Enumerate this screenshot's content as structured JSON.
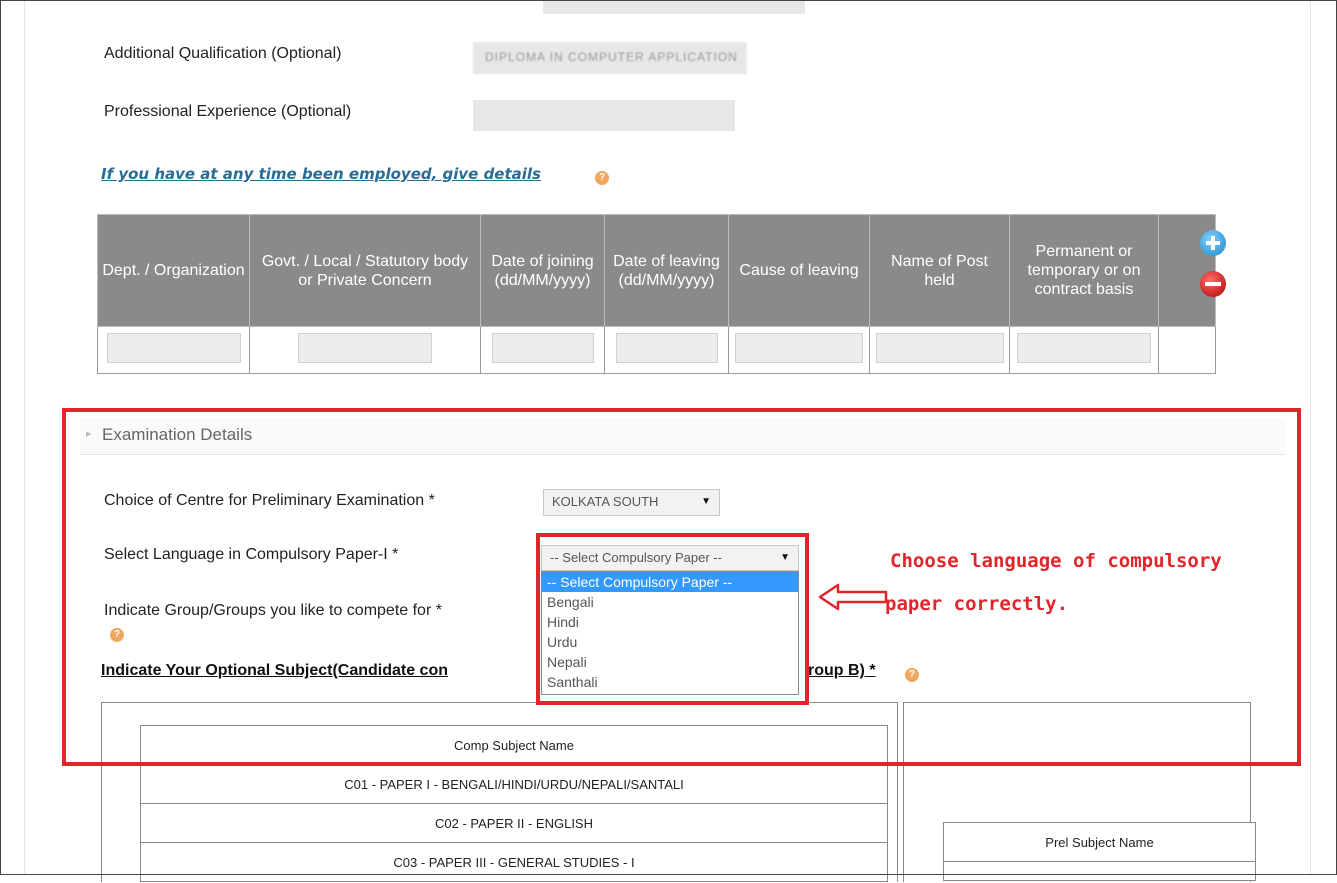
{
  "form": {
    "additional_qualification_label": "Additional Qualification (Optional)",
    "additional_qualification_value": "DIPLOMA IN COMPUTER APPLICATION",
    "professional_experience_label": "Professional Experience (Optional)",
    "professional_experience_value": ""
  },
  "employment": {
    "link_text": "If you have at any time been employed, give details",
    "columns": [
      "Dept. / Organization",
      "Govt. / Local / Statutory body or Private Concern",
      "Date of joining (dd/MM/yyyy)",
      "Date of leaving (dd/MM/yyyy)",
      "Cause of leaving",
      "Name of Post held",
      "Permanent or temporary or on contract basis"
    ],
    "add_icon": "plus-circle-icon",
    "remove_icon": "minus-circle-icon"
  },
  "exam": {
    "section_title": "Examination Details",
    "centre_label": "Choice of Centre for Preliminary Examination *",
    "centre_value": "KOLKATA SOUTH",
    "language_label": "Select Language in Compulsory Paper-I *",
    "language_value": "-- Select Compulsory Paper --",
    "language_options": [
      "-- Select Compulsory Paper --",
      "Bengali",
      "Hindi",
      "Urdu",
      "Nepali",
      "Santhali"
    ],
    "group_label": "Indicate Group/Groups you like to compete for *",
    "optional_subject_left": "Indicate Your Optional Subject(Candidate con",
    "optional_subject_right": "roup B) *"
  },
  "annotation": {
    "line1": "Choose language of compulsory",
    "line2": "paper correctly."
  },
  "subjects": {
    "comp_header": "Comp Subject Name",
    "comp_rows": [
      "C01 - PAPER I - BENGALI/HINDI/URDU/NEPALI/SANTALI",
      "C02 - PAPER II - ENGLISH",
      "C03 - PAPER III - GENERAL STUDIES - I"
    ],
    "prel_header": "Prel Subject Name"
  },
  "colors": {
    "annotation_red": "#e0262b",
    "header_grey": "#8a8a8a",
    "link_blue": "#2a6c94",
    "selected_blue": "#3399ff"
  }
}
